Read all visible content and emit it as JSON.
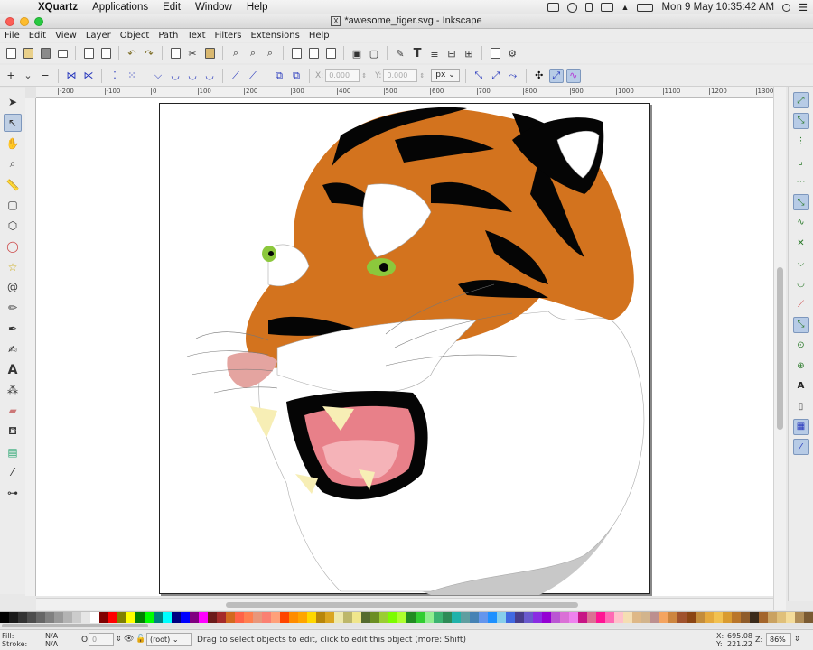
{
  "macos_menubar": {
    "app": "XQuartz",
    "items": [
      "Applications",
      "Edit",
      "Window",
      "Help"
    ],
    "datetime": "Mon 9 May  10:35:42 AM"
  },
  "window": {
    "title": "*awesome_tiger.svg - Inkscape",
    "icon_glyph": "X"
  },
  "menu": [
    "File",
    "Edit",
    "View",
    "Layer",
    "Object",
    "Path",
    "Text",
    "Filters",
    "Extensions",
    "Help"
  ],
  "controls": {
    "x_label": "X:",
    "x_value": "0.000",
    "y_label": "Y:",
    "y_value": "0.000",
    "unit": "px"
  },
  "ruler": {
    "top_ticks": [
      "-200",
      "-100",
      "0",
      "100",
      "200",
      "300",
      "400",
      "500",
      "600",
      "700",
      "800",
      "900",
      "1000",
      "1100",
      "1200",
      "1300"
    ]
  },
  "statusbar": {
    "fill_label": "Fill:",
    "fill_value": "N/A",
    "stroke_label": "Stroke:",
    "stroke_value": "N/A",
    "opacity_label": "O",
    "opacity_value": "0",
    "layer": "(root)",
    "message": "Drag to select objects to edit, click to edit this object (more: Shift)",
    "x_label": "X:",
    "x_coord": "695.08",
    "y_label": "Y:",
    "y_coord": "221.22",
    "zoom_label": "Z:",
    "zoom": "86%"
  },
  "palette_colors": [
    "#000000",
    "#1a1a1a",
    "#333333",
    "#4d4d4d",
    "#666666",
    "#808080",
    "#999999",
    "#b3b3b3",
    "#cccccc",
    "#e6e6e6",
    "#ffffff",
    "#800000",
    "#ff0000",
    "#808000",
    "#ffff00",
    "#008000",
    "#00ff00",
    "#008080",
    "#00ffff",
    "#000080",
    "#0000ff",
    "#800080",
    "#ff00ff",
    "#6b1a1a",
    "#a52a2a",
    "#d2691e",
    "#ff6347",
    "#ff7f50",
    "#e9967a",
    "#fa8072",
    "#ffa07a",
    "#ff4500",
    "#ff8c00",
    "#ffa500",
    "#ffd700",
    "#b8860b",
    "#daa520",
    "#eee8aa",
    "#bdb76b",
    "#f0e68c",
    "#556b2f",
    "#6b8e23",
    "#9acd32",
    "#7cfc00",
    "#adff2f",
    "#228b22",
    "#32cd32",
    "#90ee90",
    "#3cb371",
    "#2e8b57",
    "#20b2aa",
    "#5f9ea0",
    "#4682b4",
    "#6495ed",
    "#1e90ff",
    "#87ceeb",
    "#4169e1",
    "#483d8b",
    "#6a5acd",
    "#8a2be2",
    "#9400d3",
    "#ba55d3",
    "#da70d6",
    "#ee82ee",
    "#c71585",
    "#db7093",
    "#ff1493",
    "#ff69b4",
    "#ffc0cb",
    "#f5deb3",
    "#deb887",
    "#d2b48c",
    "#bc8f8f",
    "#f4a460",
    "#cd853f",
    "#a0522d",
    "#8b4513",
    "#c48c3a",
    "#e5a93d",
    "#f2c150",
    "#d99b30",
    "#b9762a",
    "#8f5c2a",
    "#3a2a1a",
    "#a3652b",
    "#caa261",
    "#e0c07a",
    "#f4dc9a",
    "#b08d57",
    "#7a5a32"
  ],
  "tiger_colors": {
    "orange": "#d3731e",
    "black": "#050505",
    "white": "#ffffff",
    "green_eye": "#8cc83c",
    "mouth_pink": "#e88089",
    "tongue": "#f5b3b8",
    "fang": "#f7eeb5",
    "nose": "#e4a4a0",
    "shadow": "#c8c8c8"
  }
}
